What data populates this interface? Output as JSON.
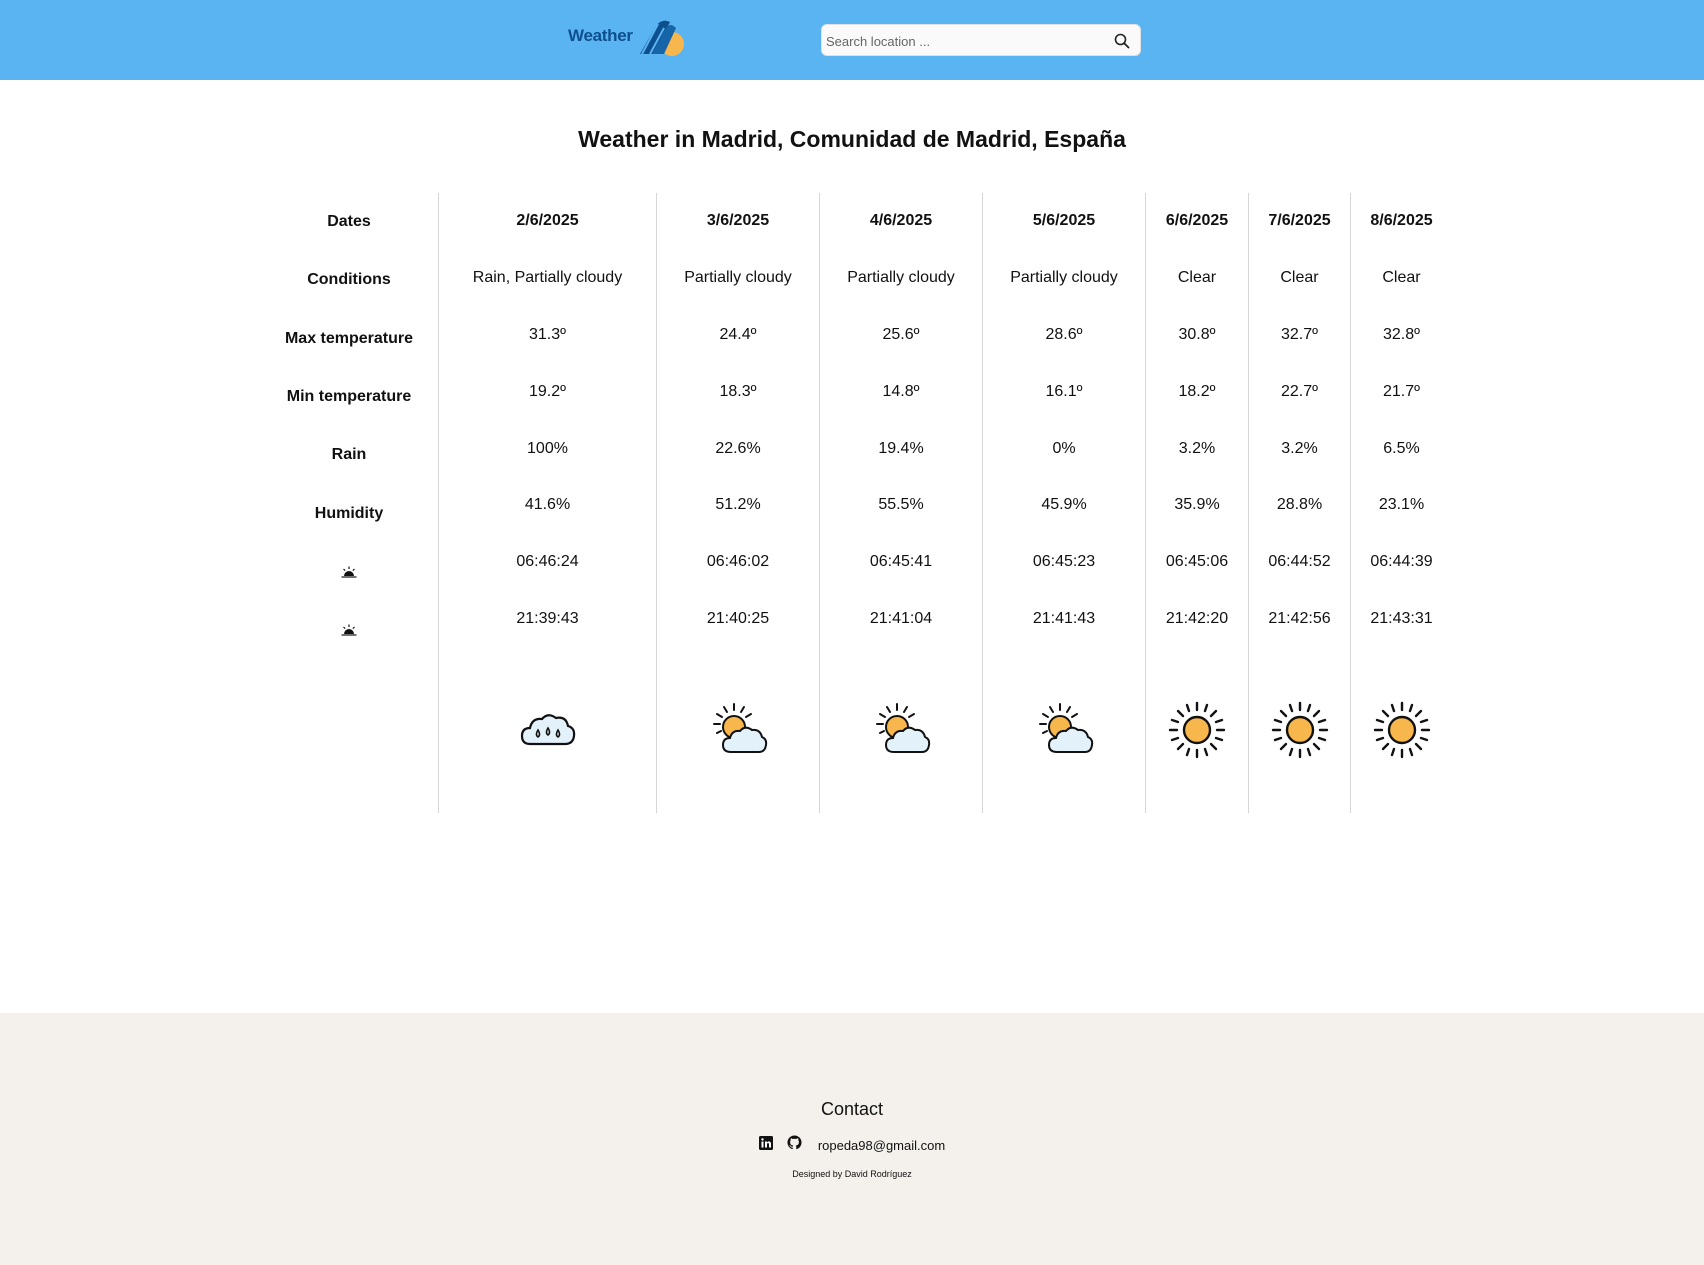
{
  "header": {
    "logo_text": "Weather",
    "search": {
      "placeholder": "Search location ...",
      "value": ""
    }
  },
  "page_title": "Weather in Madrid, Comunidad de Madrid, España",
  "forecast": {
    "row_labels": [
      "Dates",
      "Conditions",
      "Max temperature",
      "Min temperature",
      "Rain",
      "Humidity"
    ],
    "sunrise_icon": "sunrise-icon",
    "sunset_icon": "sunset-icon",
    "days": [
      {
        "date": "2/6/2025",
        "conditions": "Rain, Partially cloudy",
        "max": "31.3º",
        "min": "19.2º",
        "rain": "100%",
        "humidity": "41.6%",
        "sunrise": "06:46:24",
        "sunset": "21:39:43",
        "icon": "rain-cloud-icon"
      },
      {
        "date": "3/6/2025",
        "conditions": "Partially cloudy",
        "max": "24.4º",
        "min": "18.3º",
        "rain": "22.6%",
        "humidity": "51.2%",
        "sunrise": "06:46:02",
        "sunset": "21:40:25",
        "icon": "partly-cloudy-icon"
      },
      {
        "date": "4/6/2025",
        "conditions": "Partially cloudy",
        "max": "25.6º",
        "min": "14.8º",
        "rain": "19.4%",
        "humidity": "55.5%",
        "sunrise": "06:45:41",
        "sunset": "21:41:04",
        "icon": "partly-cloudy-icon"
      },
      {
        "date": "5/6/2025",
        "conditions": "Partially cloudy",
        "max": "28.6º",
        "min": "16.1º",
        "rain": "0%",
        "humidity": "45.9%",
        "sunrise": "06:45:23",
        "sunset": "21:41:43",
        "icon": "partly-cloudy-icon"
      },
      {
        "date": "6/6/2025",
        "conditions": "Clear",
        "max": "30.8º",
        "min": "18.2º",
        "rain": "3.2%",
        "humidity": "35.9%",
        "sunrise": "06:45:06",
        "sunset": "21:42:20",
        "icon": "sun-icon"
      },
      {
        "date": "7/6/2025",
        "conditions": "Clear",
        "max": "32.7º",
        "min": "22.7º",
        "rain": "3.2%",
        "humidity": "28.8%",
        "sunrise": "06:44:52",
        "sunset": "21:42:56",
        "icon": "sun-icon"
      },
      {
        "date": "8/6/2025",
        "conditions": "Clear",
        "max": "32.8º",
        "min": "21.7º",
        "rain": "6.5%",
        "humidity": "23.1%",
        "sunrise": "06:44:39",
        "sunset": "21:43:31",
        "icon": "sun-icon"
      }
    ]
  },
  "footer": {
    "contact_title": "Contact",
    "email": "ropeda98@gmail.com",
    "icons": [
      "linkedin-icon",
      "github-icon"
    ],
    "credit": "Designed by David Rodríguez"
  },
  "colors": {
    "header_bg": "#5ab4f2",
    "footer_bg": "#f4f1ec",
    "sun": "#f7b74c",
    "cloud": "#e3f1fb"
  }
}
